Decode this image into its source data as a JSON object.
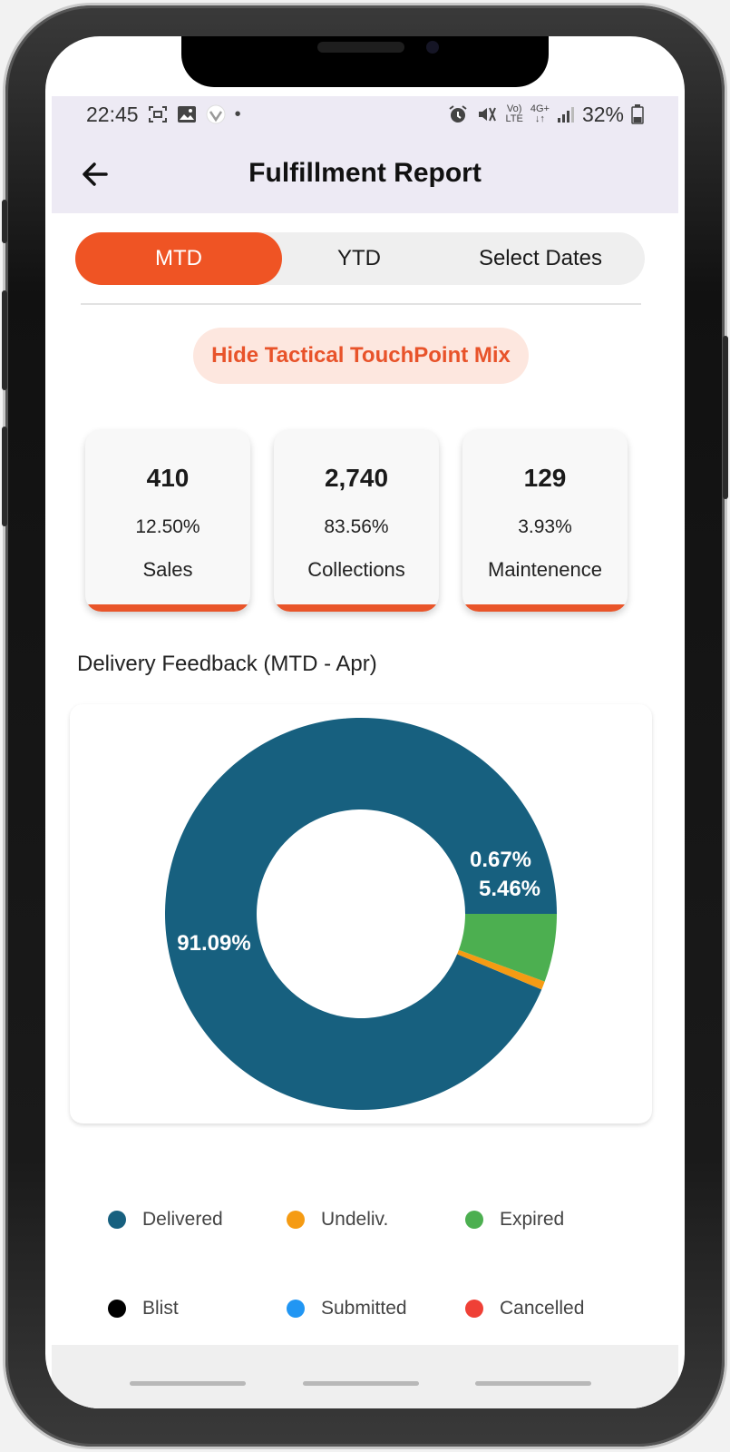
{
  "status_bar": {
    "time": "22:45",
    "dot": "•",
    "lte_top": "Vo)",
    "lte_bottom": "LTE",
    "net_top": "4G+",
    "net_bottom": "↓↑",
    "battery": "32%"
  },
  "header": {
    "title": "Fulfillment Report",
    "back_icon": "arrow-left-icon"
  },
  "tabs": [
    {
      "label": "MTD",
      "active": true
    },
    {
      "label": "YTD",
      "active": false
    },
    {
      "label": "Select Dates",
      "active": false
    }
  ],
  "toggle_button": {
    "label": "Hide Tactical TouchPoint Mix"
  },
  "cards": [
    {
      "value": "410",
      "percent": "12.50%",
      "label": "Sales"
    },
    {
      "value": "2,740",
      "percent": "83.56%",
      "label": "Collections"
    },
    {
      "value": "129",
      "percent": "3.93%",
      "label": "Maintenence"
    }
  ],
  "section": {
    "title": "Delivery Feedback (MTD - Apr)"
  },
  "chart_data": {
    "type": "pie",
    "donut": true,
    "categories": [
      "Delivered",
      "Undeliv.",
      "Expired",
      "Blist",
      "Submitted",
      "Cancelled"
    ],
    "values": [
      91.09,
      0.67,
      5.46,
      0,
      0,
      0
    ],
    "labels": [
      "91.09%",
      "0.67%",
      "5.46%",
      "",
      "",
      ""
    ],
    "colors": [
      "#17607f",
      "#f59b13",
      "#4caf50",
      "#000000",
      "#2196f3",
      "#ef4036"
    ],
    "legend_position": "bottom"
  },
  "colors": {
    "accent": "#ef5424",
    "appbar_bg": "#edeaf4",
    "pill_bg": "#fde7df"
  }
}
